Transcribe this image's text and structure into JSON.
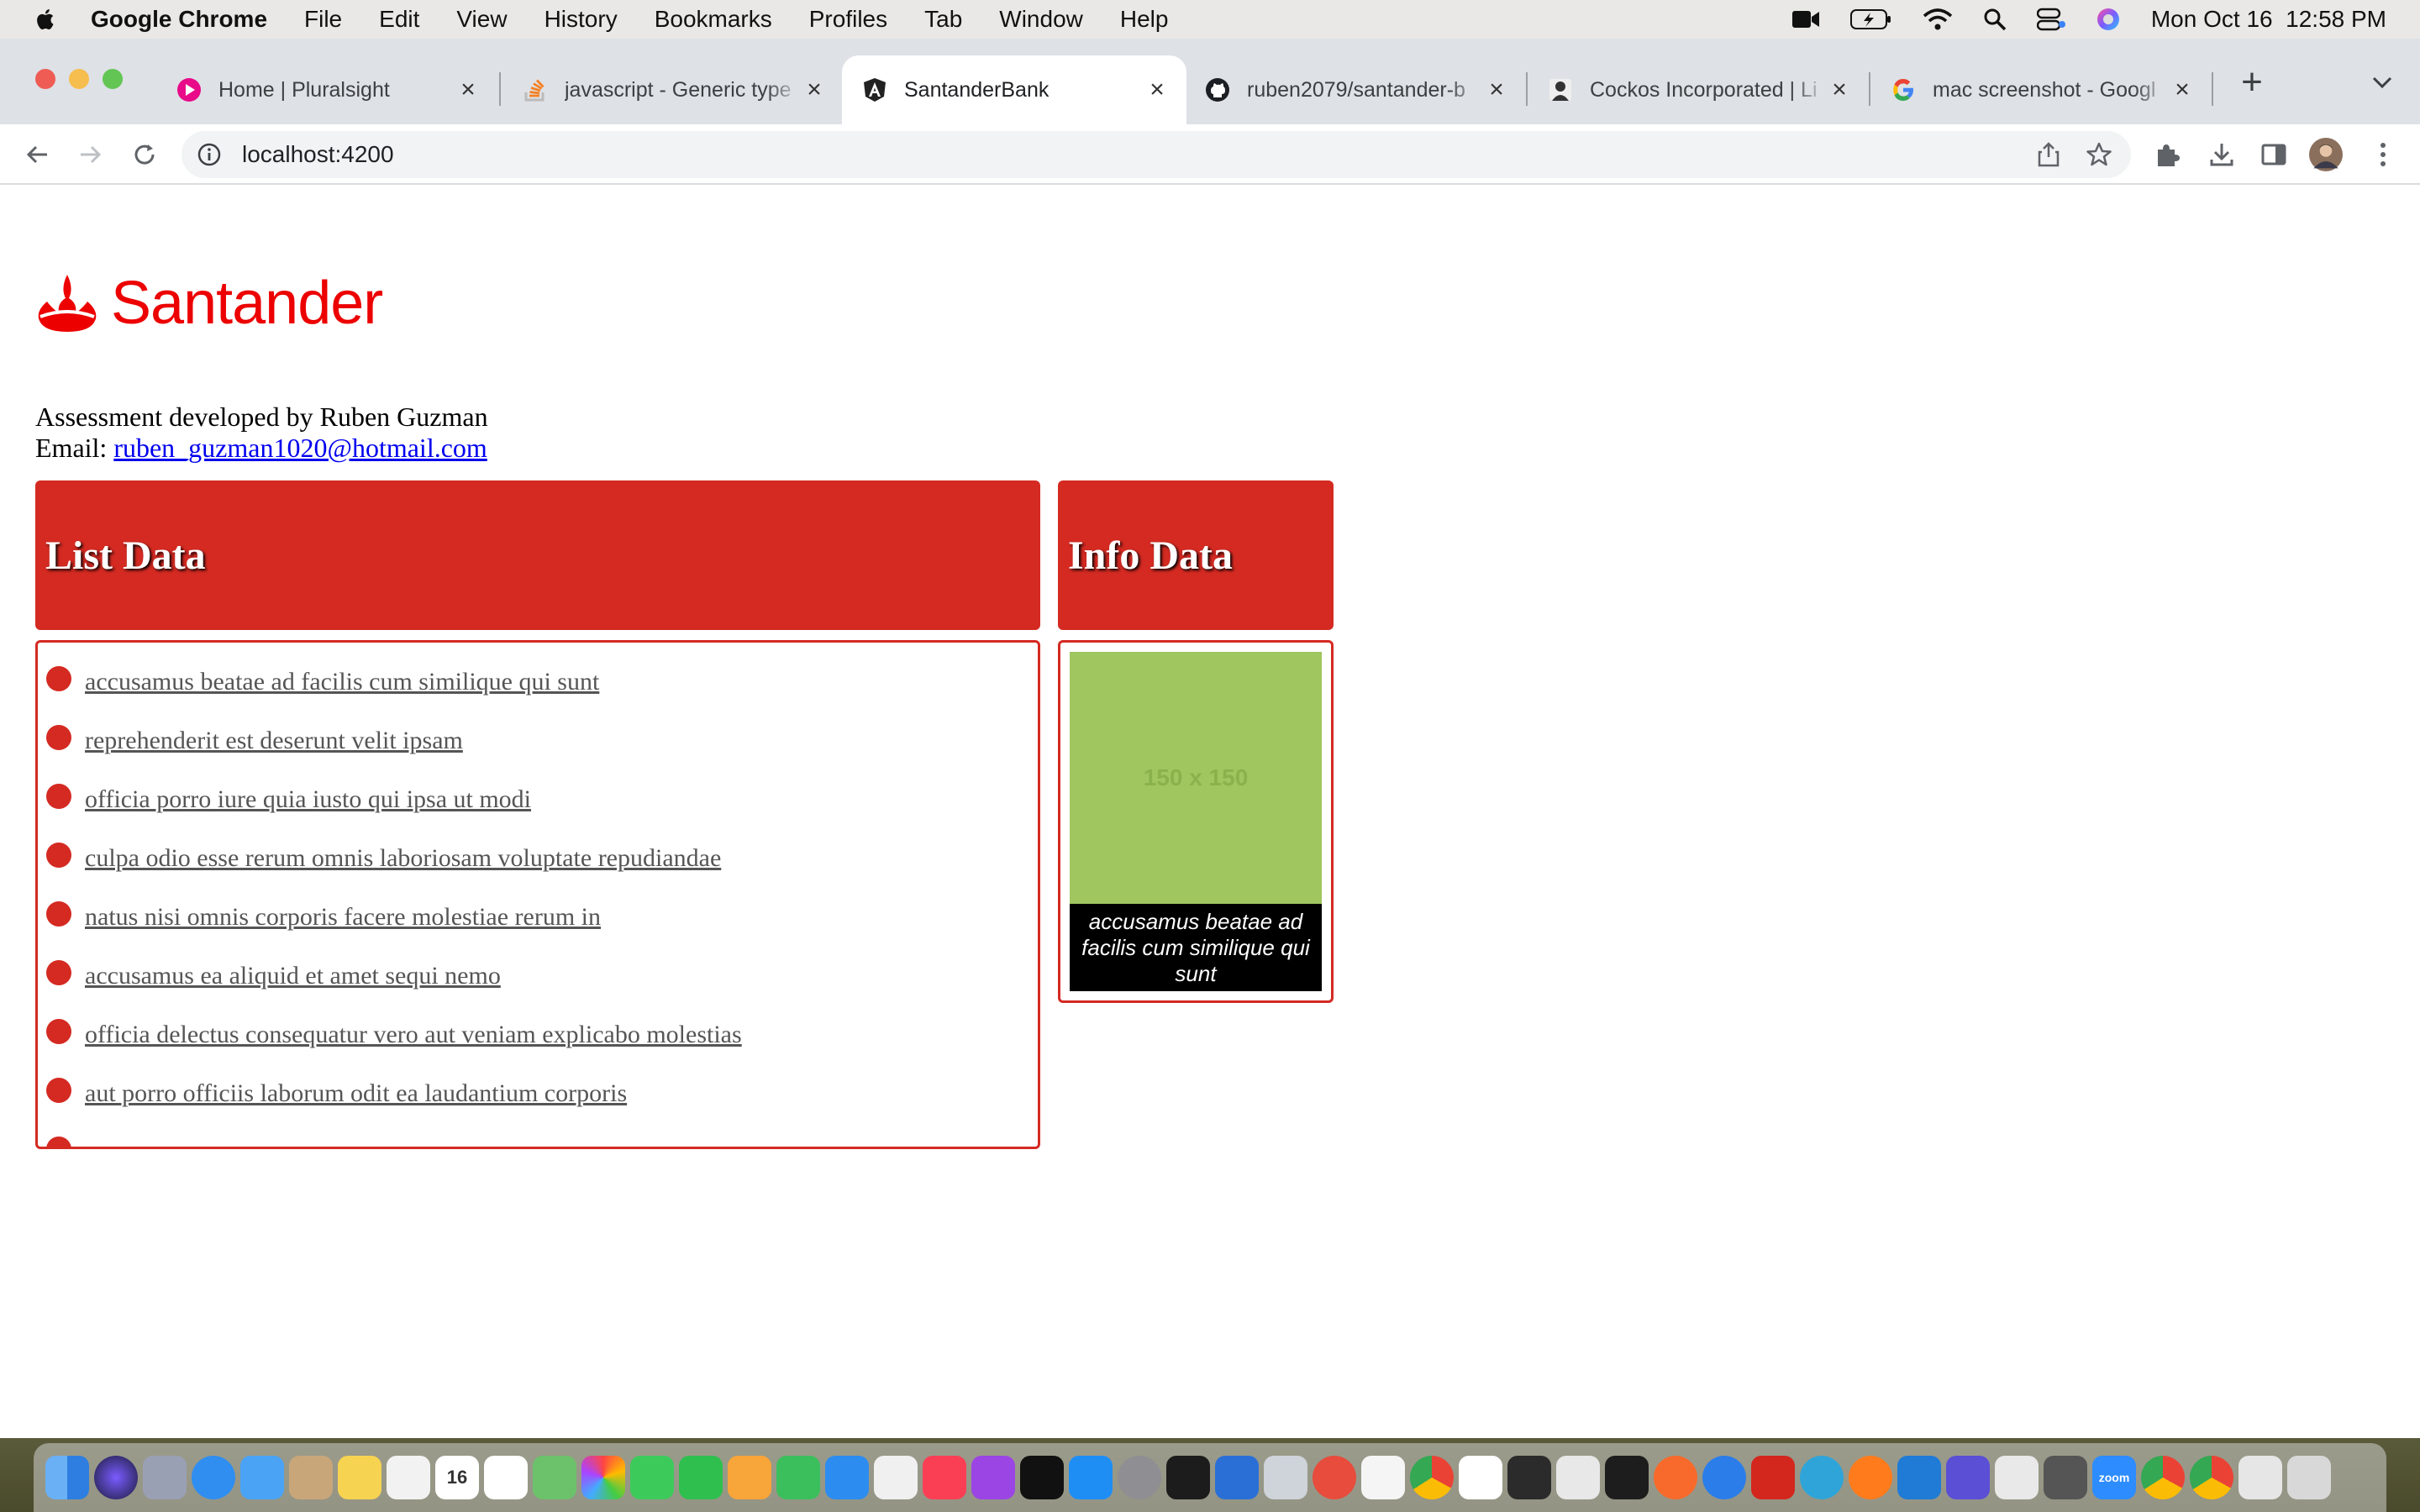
{
  "menubar": {
    "app_name": "Google Chrome",
    "menus": [
      "File",
      "Edit",
      "View",
      "History",
      "Bookmarks",
      "Profiles",
      "Tab",
      "Window",
      "Help"
    ],
    "clock": "Mon Oct 16  12:58 PM"
  },
  "tabs": [
    {
      "title": "Home | Pluralsight",
      "favicon": "pluralsight-icon",
      "active": false
    },
    {
      "title": "javascript - Generic type",
      "favicon": "stackoverflow-icon",
      "active": false
    },
    {
      "title": "SantanderBank",
      "favicon": "angular-icon",
      "active": true
    },
    {
      "title": "ruben2079/santander-b",
      "favicon": "github-icon",
      "active": false
    },
    {
      "title": "Cockos Incorporated | Li",
      "favicon": "cockos-icon",
      "active": false
    },
    {
      "title": "mac screenshot - Googl",
      "favicon": "google-icon",
      "active": false
    }
  ],
  "toolbar": {
    "url": "localhost:4200"
  },
  "page": {
    "brand": "Santander",
    "credit_line": "Assessment developed by Ruben Guzman",
    "email_label": "Email:",
    "email": "ruben_guzman1020@hotmail.com",
    "list_title": "List Data",
    "info_title": "Info Data",
    "list_items": [
      "accusamus beatae ad facilis cum similique qui sunt",
      "reprehenderit est deserunt velit ipsam",
      "officia porro iure quia iusto qui ipsa ut modi",
      "culpa odio esse rerum omnis laboriosam voluptate repudiandae",
      "natus nisi omnis corporis facere molestiae rerum in",
      "accusamus ea aliquid et amet sequi nemo",
      "officia delectus consequatur vero aut veniam explicabo molestias",
      "aut porro officiis laborum odit ea laudantium corporis"
    ],
    "placeholder_text": "150 x 150",
    "caption": "accusamus beatae ad facilis cum similique qui sunt"
  },
  "colors": {
    "brand_red": "#ec0000",
    "panel_red": "#d42a22",
    "placeholder_green": "#a0c660"
  }
}
